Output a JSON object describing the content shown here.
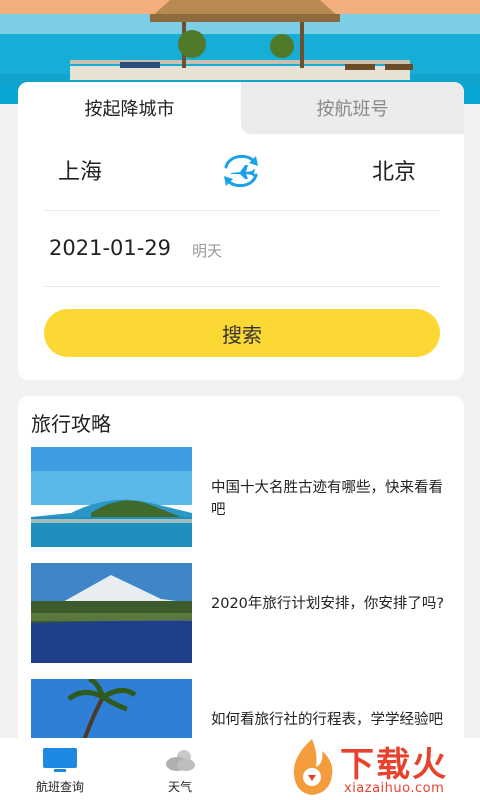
{
  "search": {
    "tabs": [
      {
        "label": "按起降城市",
        "active": true
      },
      {
        "label": "按航班号",
        "active": false
      }
    ],
    "from_city": "上海",
    "to_city": "北京",
    "date": "2021-01-29",
    "date_note": "明天",
    "search_label": "搜索",
    "accent_color": "#fcd835",
    "swap_icon_color": "#1aa1e6"
  },
  "guides": {
    "title": "旅行攻略",
    "articles": [
      {
        "title": "中国十大名胜古迹有哪些，快来看看吧",
        "thumb": "island-beach-image"
      },
      {
        "title": "2020年旅行计划安排，你安排了吗?",
        "thumb": "mountain-lake-image"
      },
      {
        "title": "如何看旅行社的行程表，学学经验吧",
        "thumb": "palm-beach-image"
      }
    ]
  },
  "bottom_nav": {
    "items": [
      {
        "label": "航班查询",
        "icon": "monitor-icon",
        "active": true
      },
      {
        "label": "天气",
        "icon": "weather-icon",
        "active": false
      }
    ]
  },
  "watermark": {
    "text": "下载火",
    "sub": "xiazaihuo.com"
  }
}
